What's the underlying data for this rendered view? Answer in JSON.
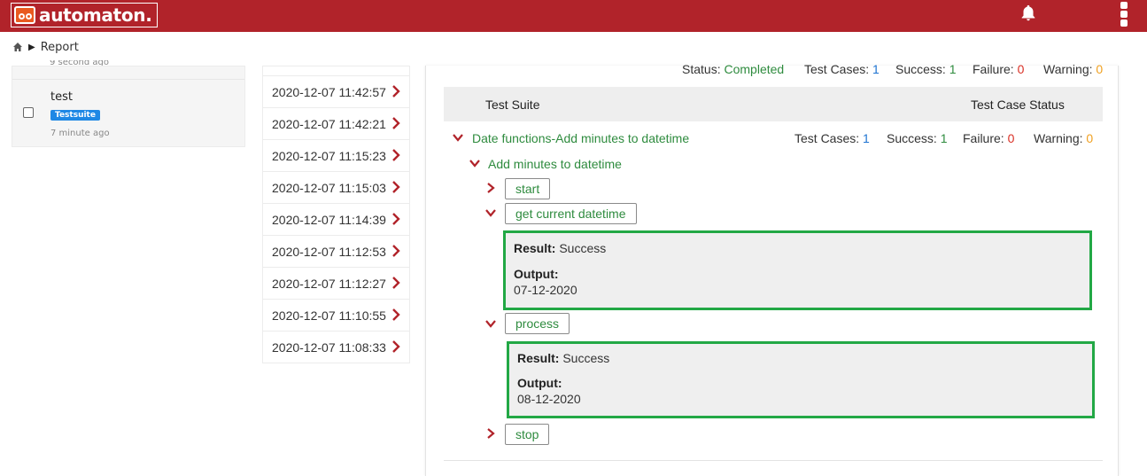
{
  "app": {
    "name": "automaton."
  },
  "breadcrumb": {
    "current": "Report"
  },
  "left_list": {
    "top_fragment": "9 second ago",
    "item": {
      "title": "test",
      "badge": "Testsuite",
      "time": "7 minute ago"
    }
  },
  "dates": [
    "2020-12-07 11:42:57",
    "2020-12-07 11:42:21",
    "2020-12-07 11:15:23",
    "2020-12-07 11:15:03",
    "2020-12-07 11:14:39",
    "2020-12-07 11:12:53",
    "2020-12-07 11:12:27",
    "2020-12-07 11:10:55",
    "2020-12-07 11:08:33"
  ],
  "summary": {
    "status_label": "Status:",
    "status_value": "Completed",
    "test_cases_label": "Test Cases:",
    "test_cases_value": "1",
    "success_label": "Success:",
    "success_value": "1",
    "failure_label": "Failure:",
    "failure_value": "0",
    "warning_label": "Warning:",
    "warning_value": "0"
  },
  "table_header": {
    "test_suite": "Test Suite",
    "test_case_status": "Test Case Status"
  },
  "suite": {
    "title": "Date functions-Add minutes to datetime",
    "test_cases_label": "Test Cases:",
    "test_cases_value": "1",
    "success_label": "Success:",
    "success_value": "1",
    "failure_label": "Failure:",
    "failure_value": "0",
    "warning_label": "Warning:",
    "warning_value": "0",
    "test_case": {
      "title": "Add minutes to datetime",
      "steps": [
        {
          "label": "start"
        },
        {
          "label": "get current datetime",
          "result_label": "Result:",
          "result_value": "Success",
          "output_label": "Output:",
          "output_value": "07-12-2020"
        },
        {
          "label": "process",
          "result_label": "Result:",
          "result_value": "Success",
          "output_label": "Output:",
          "output_value": "08-12-2020"
        },
        {
          "label": "stop"
        }
      ]
    }
  },
  "colors": {
    "header": "#b1232a",
    "success": "#2e8b3e",
    "info": "#1e73d1",
    "failure": "#d93025",
    "warning": "#f0a020",
    "highlight": "#22a845"
  }
}
